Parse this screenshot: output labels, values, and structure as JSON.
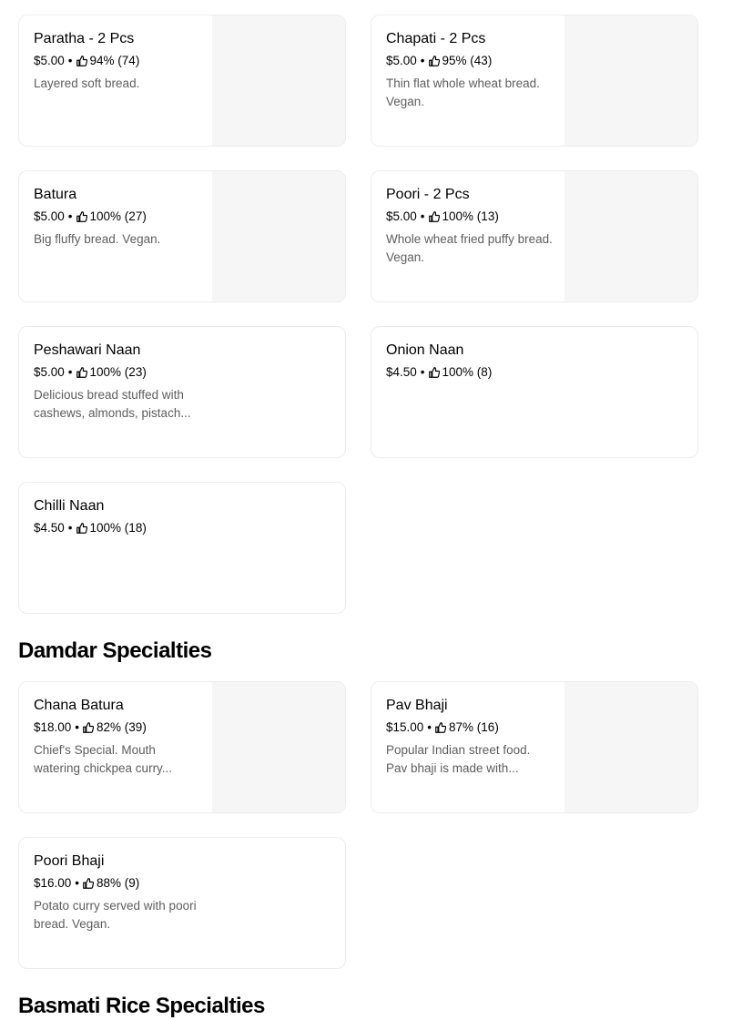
{
  "items": [
    {
      "name": "Paratha - 2 Pcs",
      "price": "$5.00",
      "dot": "•",
      "rating": "94% (74)",
      "desc": "Layered soft bread."
    },
    {
      "name": "Chapati - 2 Pcs",
      "price": "$5.00",
      "dot": "•",
      "rating": "95% (43)",
      "desc": "Thin flat whole wheat bread. Vegan."
    },
    {
      "name": "Batura",
      "price": "$5.00",
      "dot": "•",
      "rating": "100% (27)",
      "desc": "Big fluffy bread. Vegan."
    },
    {
      "name": "Poori - 2 Pcs",
      "price": "$5.00",
      "dot": "•",
      "rating": "100% (13)",
      "desc": "Whole wheat fried puffy bread. Vegan."
    },
    {
      "name": "Peshawari Naan",
      "price": "$5.00",
      "dot": "•",
      "rating": "100% (23)",
      "desc": "Delicious bread stuffed with cashews, almonds, pistach..."
    },
    {
      "name": "Onion Naan",
      "price": "$4.50",
      "dot": "•",
      "rating": "100% (8)",
      "desc": ""
    },
    {
      "name": "Chilli Naan",
      "price": "$4.50",
      "dot": "•",
      "rating": "100% (18)",
      "desc": ""
    }
  ],
  "sections": [
    {
      "title": "Damdar Specialties",
      "items": [
        {
          "name": "Chana Batura",
          "price": "$18.00",
          "dot": "•",
          "rating": "82% (39)",
          "desc": "Chief's Special. Mouth watering chickpea curry..."
        },
        {
          "name": "Pav Bhaji",
          "price": "$15.00",
          "dot": "•",
          "rating": "87% (16)",
          "desc": "Popular Indian street food. Pav bhaji is made with..."
        },
        {
          "name": "Poori Bhaji",
          "price": "$16.00",
          "dot": "•",
          "rating": "88% (9)",
          "desc": "Potato curry served with poori bread. Vegan."
        }
      ]
    },
    {
      "title": "Basmati Rice Specialties",
      "items": []
    }
  ],
  "icons": {
    "rating": "thumbs-up-icon"
  },
  "colors": {
    "card_border": "#ececec",
    "image_placeholder": "#f6f6f6",
    "description": "#5e5e5e"
  }
}
